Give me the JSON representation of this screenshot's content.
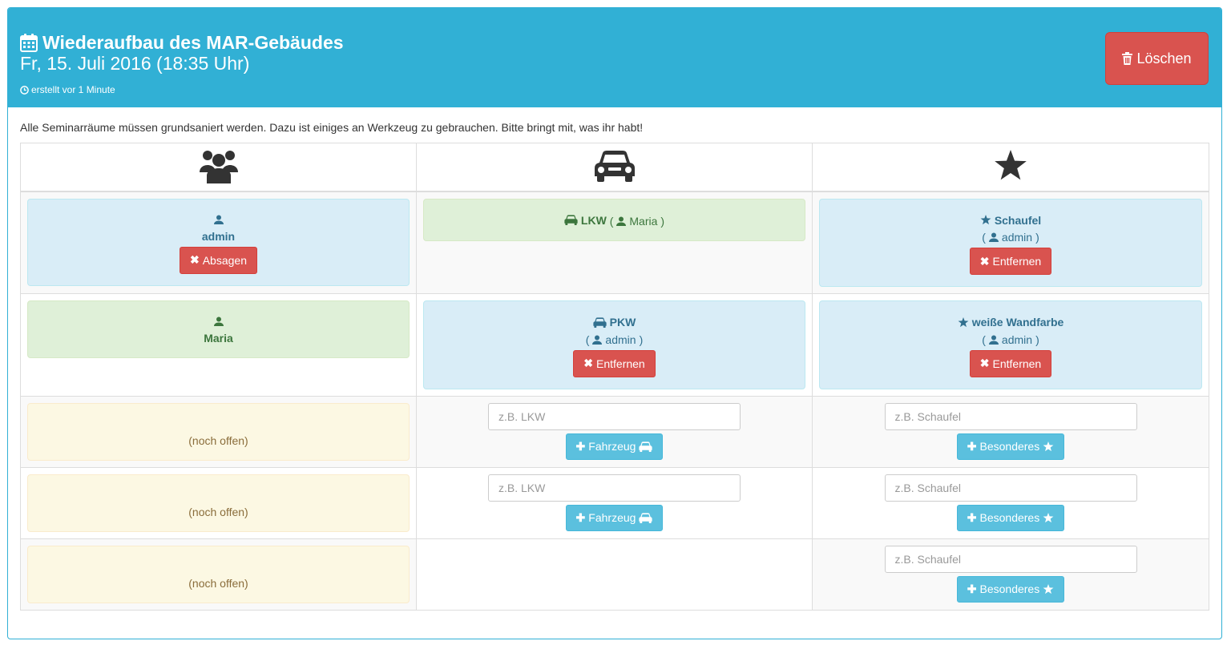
{
  "header": {
    "title": "Wiederaufbau des MAR-Gebäudes",
    "date": "Fr, 15. Juli 2016 (18:35 Uhr)",
    "created": "erstellt vor 1 Minute",
    "delete_label": "Löschen"
  },
  "description": "Alle Seminarräume müssen grundsaniert werden. Dazu ist einiges an Werkzeug zu gebrauchen. Bitte bringt mit, was ihr habt!",
  "columns": [
    {
      "icon": "users-icon"
    },
    {
      "icon": "car-icon"
    },
    {
      "icon": "star-icon"
    }
  ],
  "participants": [
    {
      "name": "admin",
      "button": "Absagen"
    },
    {
      "name": "Maria"
    }
  ],
  "open_label": "(noch offen)",
  "vehicles": [
    {
      "name": "LKW",
      "owner_open": "(",
      "owner": "Maria",
      "owner_close": ")"
    },
    {
      "name": "PKW",
      "owner_open": "(",
      "owner": "admin",
      "owner_close": ")",
      "button": "Entfernen"
    }
  ],
  "specials": [
    {
      "name": "Schaufel",
      "owner_open": "(",
      "owner": "admin",
      "owner_close": ")",
      "button": "Entfernen"
    },
    {
      "name": "weiße Wandfarbe",
      "owner_open": "(",
      "owner": "admin",
      "owner_close": ")",
      "button": "Entfernen"
    }
  ],
  "vehicle_form": {
    "placeholder": "z.B. LKW",
    "button": "Fahrzeug"
  },
  "special_form": {
    "placeholder": "z.B. Schaufel",
    "button": "Besonderes"
  }
}
